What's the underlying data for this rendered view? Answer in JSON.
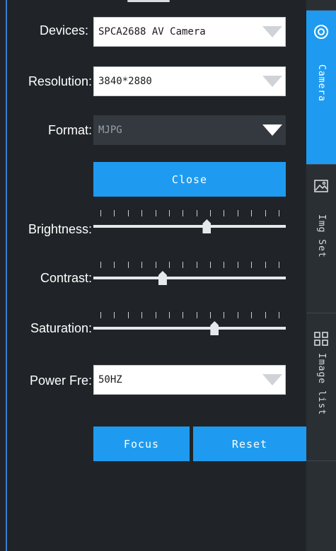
{
  "form": {
    "devices": {
      "label": "Devices:",
      "value": "SPCA2688 AV Camera"
    },
    "resolution": {
      "label": "Resolution:",
      "value": "3840*2880"
    },
    "format": {
      "label": "Format:",
      "value": "MJPG"
    },
    "close_label": "Close",
    "power": {
      "label": "Power Fre:",
      "value": "50HZ"
    },
    "focus_label": "Focus",
    "reset_label": "Reset"
  },
  "sliders": {
    "brightness": {
      "label": "Brightness:",
      "level": 0.59
    },
    "contrast": {
      "label": "Contrast:",
      "level": 0.36
    },
    "saturation": {
      "label": "Saturation:",
      "level": 0.63
    }
  },
  "sidebar": {
    "tabs": [
      {
        "label": "Camera",
        "icon": "camera-icon",
        "active": true
      },
      {
        "label": "Img Set",
        "icon": "image-icon",
        "active": false
      },
      {
        "label": "Image list",
        "icon": "grid-icon",
        "active": false
      }
    ]
  },
  "colors": {
    "accent": "#1e9bf0",
    "panel": "#202428",
    "sidebar": "#2a2f34"
  }
}
